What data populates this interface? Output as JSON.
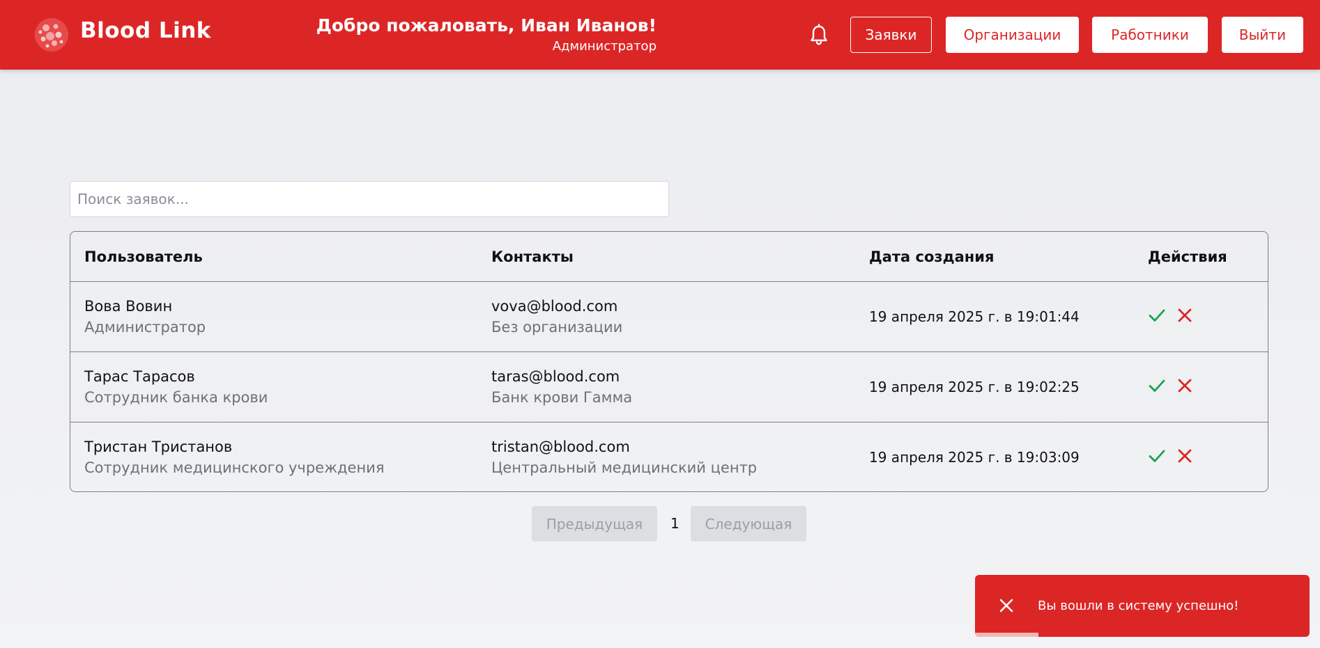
{
  "header": {
    "brand": "Blood Link",
    "welcome_title": "Добро пожаловать, Иван Иванов!",
    "welcome_role": "Администратор",
    "nav": [
      {
        "label": "Заявки",
        "active": true
      },
      {
        "label": "Организации",
        "active": false
      },
      {
        "label": "Работники",
        "active": false
      },
      {
        "label": "Выйти",
        "active": false
      }
    ],
    "accent_color": "#dc2626"
  },
  "search": {
    "placeholder": "Поиск заявок...",
    "value": ""
  },
  "table": {
    "columns": [
      "Пользователь",
      "Контакты",
      "Дата создания",
      "Действия"
    ],
    "rows": [
      {
        "name": "Вова Вовин",
        "role": "Администратор",
        "email": "vova@blood.com",
        "org": "Без организации",
        "date": "19 апреля 2025 г. в 19:01:44"
      },
      {
        "name": "Тарас Тарасов",
        "role": "Сотрудник банка крови",
        "email": "taras@blood.com",
        "org": "Банк крови Гамма",
        "date": "19 апреля 2025 г. в 19:02:25"
      },
      {
        "name": "Тристан Тристанов",
        "role": "Сотрудник медицинского учреждения",
        "email": "tristan@blood.com",
        "org": "Центральный медицинский центр",
        "date": "19 апреля 2025 г. в 19:03:09"
      }
    ]
  },
  "pagination": {
    "prev_label": "Предыдущая",
    "page": "1",
    "next_label": "Следующая"
  },
  "toast": {
    "message": "Вы вошли в систему успешно!",
    "progress": 0.19
  },
  "icons": {
    "logo": "blood-cells-logo",
    "bell": "bell-icon",
    "approve": "check-icon",
    "reject": "close-icon"
  }
}
